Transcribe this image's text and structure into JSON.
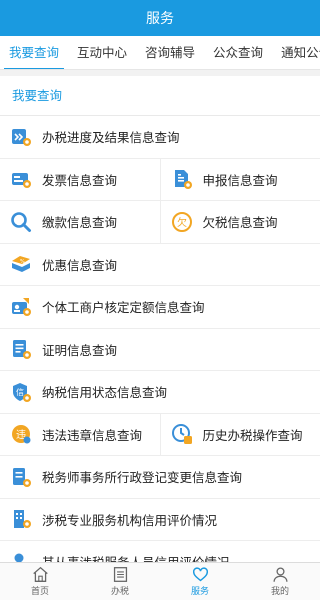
{
  "header": {
    "title": "服务"
  },
  "tabs": [
    {
      "label": "我要查询",
      "active": true
    },
    {
      "label": "互动中心"
    },
    {
      "label": "咨询辅导"
    },
    {
      "label": "公众查询"
    },
    {
      "label": "通知公告"
    }
  ],
  "section": {
    "title": "我要查询"
  },
  "items": {
    "progress": "办税进度及结果信息查询",
    "invoice": "发票信息查询",
    "declare": "申报信息查询",
    "payment": "缴款信息查询",
    "arrears": "欠税信息查询",
    "preferential": "优惠信息查询",
    "fixed_quota": "个体工商户核定定额信息查询",
    "certificate": "证明信息查询",
    "credit_status": "纳税信用状态信息查询",
    "violation": "违法违章信息查询",
    "history": "历史办税操作查询",
    "agency_change": "税务师事务所行政登记变更信息查询",
    "org_rating": "涉税专业服务机构信用评价情况",
    "staff_rating": "其从事涉税服务人员信用评价情况"
  },
  "bottom_nav": [
    {
      "label": "首页",
      "icon": "home-icon"
    },
    {
      "label": "办税",
      "icon": "document-icon"
    },
    {
      "label": "服务",
      "icon": "heart-icon",
      "active": true
    },
    {
      "label": "我的",
      "icon": "person-icon"
    }
  ],
  "colors": {
    "primary": "#1a9ae0",
    "icon_orange": "#f2a623",
    "icon_blue": "#3a8fd8"
  }
}
